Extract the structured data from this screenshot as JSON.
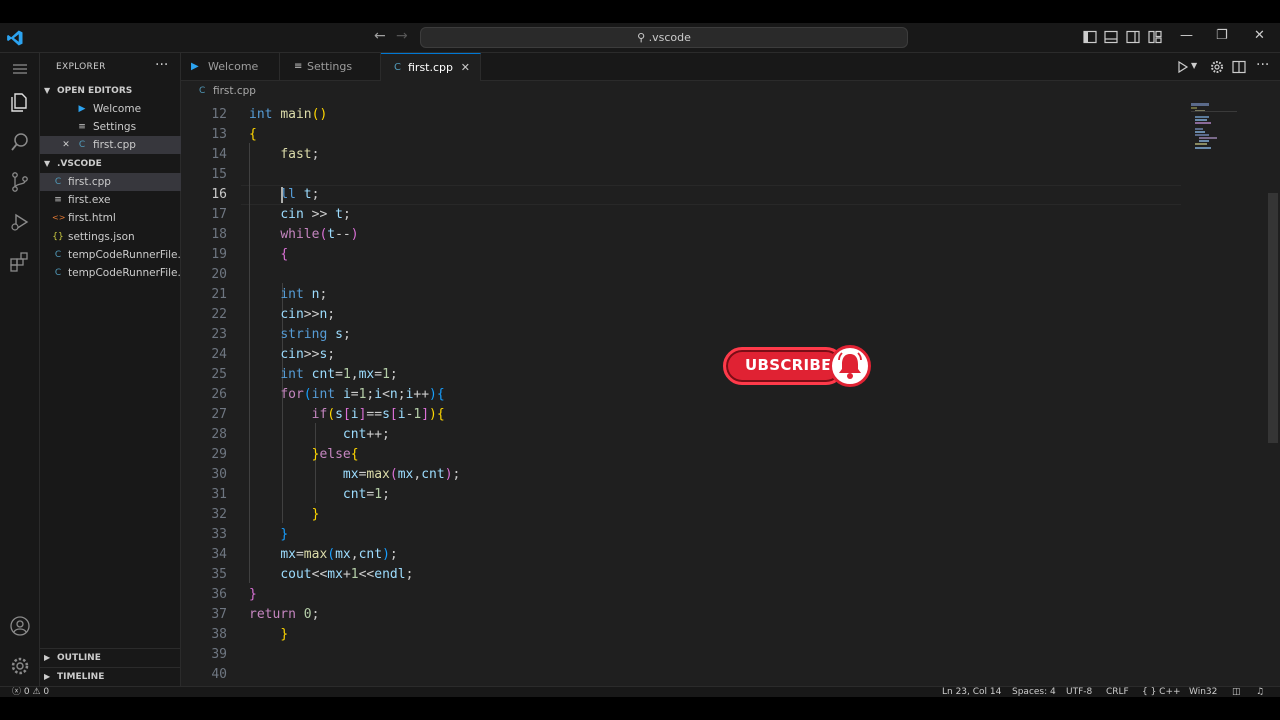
{
  "titlebar": {
    "search_text": ".vscode",
    "back_icon": "arrow-left-icon",
    "forward_icon": "arrow-right-icon"
  },
  "sidebar": {
    "title": "EXPLORER",
    "more": "···",
    "open_editors_label": "OPEN EDITORS",
    "open_editors": [
      {
        "label": "Welcome",
        "icon": "vscode-icon"
      },
      {
        "label": "Settings",
        "icon": "settings-file-icon"
      },
      {
        "label": "first.cpp",
        "icon": "cpp-file-icon"
      }
    ],
    "folder_label": ".VSCODE",
    "files": [
      {
        "label": "first.cpp",
        "icon": "cpp-file-icon",
        "glyph": "C"
      },
      {
        "label": "first.exe",
        "icon": "exe-file-icon",
        "glyph": "≡"
      },
      {
        "label": "first.html",
        "icon": "html-file-icon",
        "glyph": "<>"
      },
      {
        "label": "settings.json",
        "icon": "json-file-icon",
        "glyph": "{}"
      },
      {
        "label": "tempCodeRunnerFile...",
        "icon": "cpp-file-icon",
        "glyph": "C"
      },
      {
        "label": "tempCodeRunnerFile...",
        "icon": "cpp-file-icon",
        "glyph": "C"
      }
    ],
    "outline_label": "OUTLINE",
    "timeline_label": "TIMELINE"
  },
  "tabs": [
    {
      "label": "Welcome",
      "icon": "vscode-icon"
    },
    {
      "label": "Settings",
      "icon": "settings-file-icon"
    },
    {
      "label": "first.cpp",
      "icon": "cpp-file-icon",
      "close": "✕"
    }
  ],
  "breadcrumb": {
    "file": "first.cpp",
    "glyph": "C"
  },
  "editor": {
    "line_numbers": [
      "12",
      "13",
      "14",
      "15",
      "16",
      "17",
      "18",
      "19",
      "20",
      "21",
      "22",
      "23",
      "24",
      "25",
      "26",
      "27",
      "28",
      "29",
      "30",
      "31",
      "32",
      "33",
      "34",
      "35",
      "36",
      "37",
      "38",
      "39",
      "40"
    ],
    "current_line": "16"
  },
  "subscribe": {
    "label": "UBSCRIBE"
  },
  "statusbar": {
    "problems": "ⓧ 0 ⚠ 0",
    "position": "Ln 23, Col 14",
    "spaces": "Spaces: 4",
    "encoding": "UTF-8",
    "eol": "CRLF",
    "language": "{ } C++",
    "platform": "Win32"
  },
  "colors": {
    "accent": "#0078d4",
    "editor_bg": "#1f1f1f",
    "sidebar_bg": "#181818",
    "subscribe_red": "#e02233"
  }
}
